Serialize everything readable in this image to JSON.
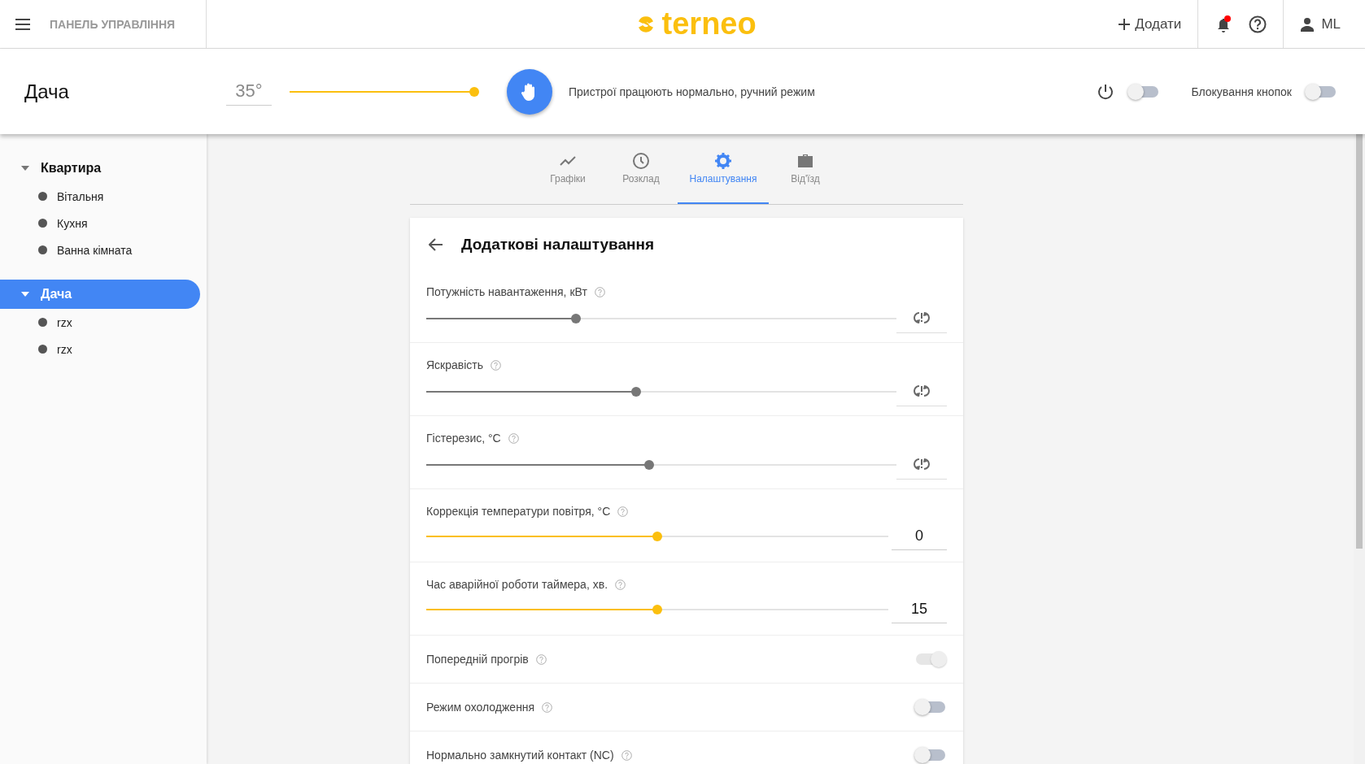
{
  "header": {
    "section_title": "ПАНЕЛЬ УПРАВЛІННЯ",
    "logo": "terneo",
    "add_button": "Додати",
    "user": "ML"
  },
  "top_panel": {
    "title": "Дача",
    "temperature": {
      "value": "35°",
      "level": 1
    },
    "status": "Пристрої працюють нормально, ручний режим",
    "power": {
      "on": false
    },
    "button_lock": {
      "label": "Блокування кнопок",
      "on": false
    }
  },
  "sidebar": {
    "groups": [
      {
        "label": "Квартира",
        "expanded": true,
        "selected": false,
        "children": [
          {
            "label": "Вітальня"
          },
          {
            "label": "Кухня"
          },
          {
            "label": "Ванна кімната"
          }
        ]
      },
      {
        "label": "Дача",
        "expanded": true,
        "selected": true,
        "children": [
          {
            "label": "rzx"
          },
          {
            "label": "rzx"
          }
        ]
      }
    ]
  },
  "tabs": [
    {
      "label": "Графіки",
      "selected": false
    },
    {
      "label": "Розклад",
      "selected": false
    },
    {
      "label": "Налаштування",
      "selected": true
    },
    {
      "label": "Від'їзд",
      "selected": false
    }
  ],
  "panel": {
    "title": "Додаткові налаштування",
    "settings": [
      {
        "kind": "slider_reset",
        "label": "Потужність навантаження, кВт",
        "level": 0.315
      },
      {
        "kind": "slider_reset",
        "label": "Яскравість",
        "level": 0.446
      },
      {
        "kind": "slider_reset",
        "label": "Гістерезис, °C",
        "level": 0.474
      },
      {
        "kind": "slider_value",
        "label": "Коррекція температури повітря, °C",
        "level": 0.5,
        "value": "0"
      },
      {
        "kind": "slider_value",
        "label": "Час аварійної роботи таймера, хв.",
        "level": 0.5,
        "value": "15"
      },
      {
        "kind": "toggle",
        "label": "Попередній прогрів",
        "on": true,
        "disabled": true
      },
      {
        "kind": "toggle",
        "label": "Режим охолодження",
        "on": false,
        "disabled": false
      },
      {
        "kind": "toggle",
        "label": "Нормально замкнутий контакт (NC)",
        "on": false,
        "disabled": false
      }
    ]
  }
}
